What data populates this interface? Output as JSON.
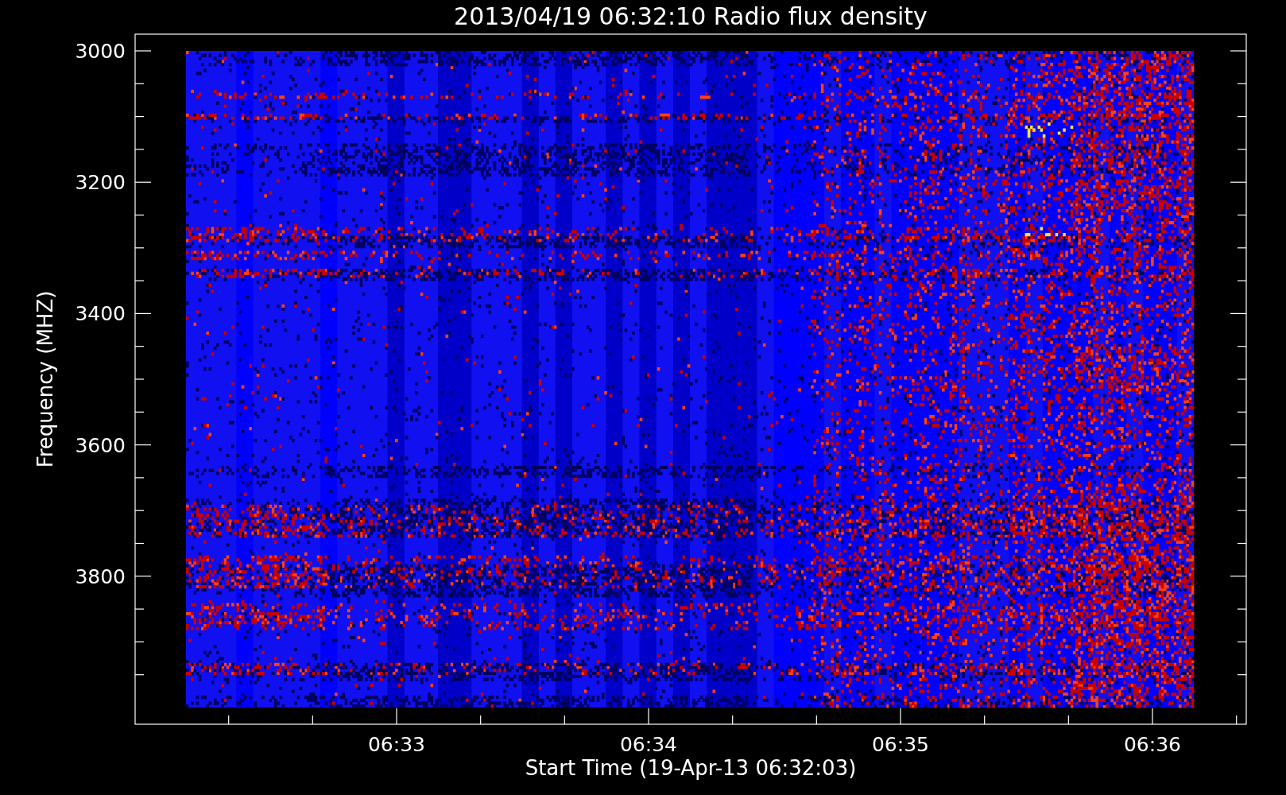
{
  "title": "2013/04/19 06:32:10 Radio flux density",
  "y_axis": {
    "label": "Frequency (MHZ)",
    "ticks": [
      "3000",
      "3200",
      "3400",
      "3600",
      "3800"
    ]
  },
  "x_axis": {
    "label": "Start Time (19-Apr-13 06:32:03)",
    "ticks": [
      "06:33",
      "06:34",
      "06:35",
      "06:36"
    ]
  }
}
